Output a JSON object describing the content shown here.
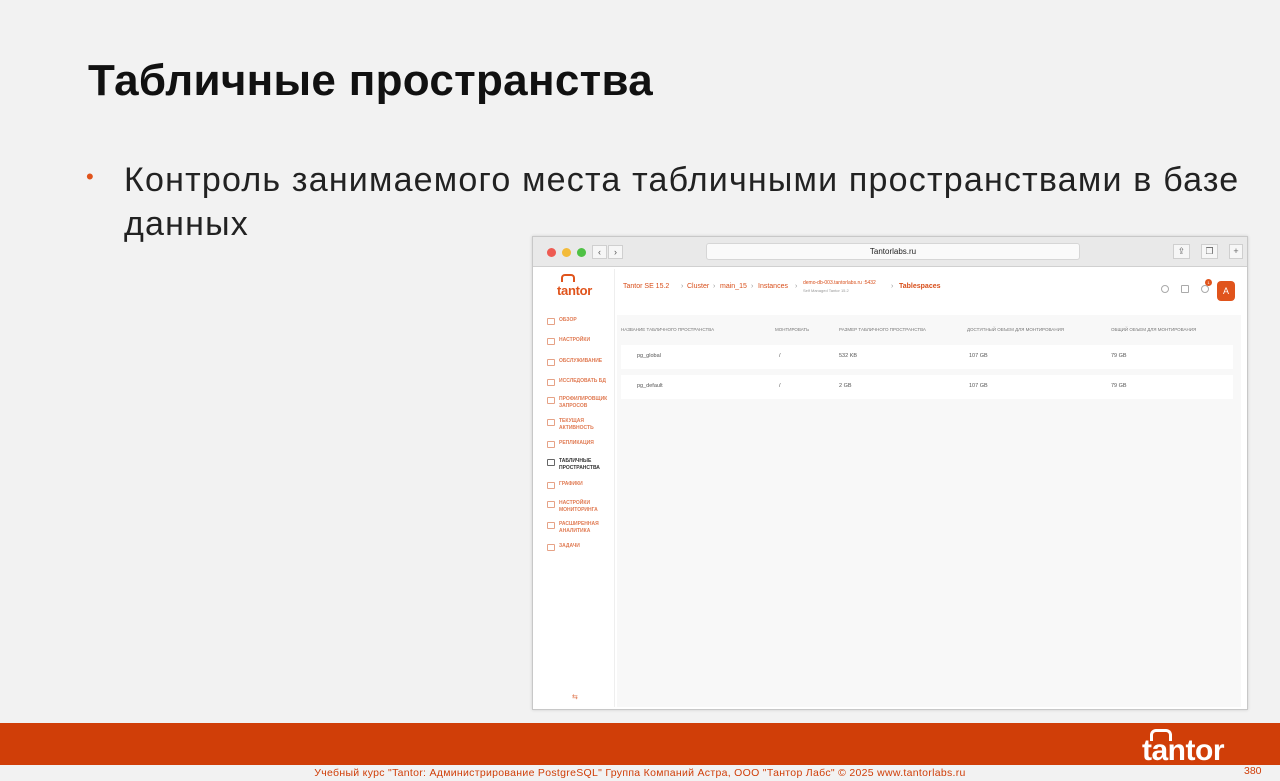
{
  "slide": {
    "title": "Табличные пространства",
    "bullet_text": "Контроль занимаемого места табличными пространствами в базе данных"
  },
  "browser": {
    "url": "Tantorlabs.ru"
  },
  "app": {
    "logo": "tantor",
    "breadcrumb": {
      "product": "Tantor SE 15.2",
      "cluster": "Cluster",
      "db": "main_15",
      "instances": "Instances",
      "host": "demo-db-003.tantorlabs.ru :5432",
      "host_sub": "Self Managed Tantor 15.2",
      "current": "Tablespaces"
    },
    "notifications_count": "1",
    "avatar_letter": "A",
    "sidebar": [
      {
        "label": "ОБЗОР",
        "icon": "overview-icon"
      },
      {
        "label": "НАСТРОЙКИ",
        "icon": "settings-icon"
      },
      {
        "label": "ОБСЛУЖИВАНИЕ",
        "icon": "maintenance-icon"
      },
      {
        "label": "ИССЛЕДОВАТЬ БД",
        "icon": "explore-icon"
      },
      {
        "label": "ПРОФИЛИРОВЩИК ЗАПРОСОВ",
        "icon": "profiler-icon"
      },
      {
        "label": "ТЕКУЩАЯ АКТИВНОСТЬ",
        "icon": "activity-icon"
      },
      {
        "label": "РЕПЛИКАЦИЯ",
        "icon": "replication-icon"
      },
      {
        "label": "ТАБЛИЧНЫЕ ПРОСТРАНСТВА",
        "icon": "tablespaces-icon",
        "active": true
      },
      {
        "label": "ГРАФИКИ",
        "icon": "graphs-icon"
      },
      {
        "label": "НАСТРОЙКИ МОНИТОРИНГА",
        "icon": "monitoring-settings-icon"
      },
      {
        "label": "РАСШИРЕННАЯ АНАЛИТИКА",
        "icon": "analytics-icon"
      },
      {
        "label": "ЗАДАЧИ",
        "icon": "tasks-icon"
      }
    ],
    "table": {
      "columns": [
        "НАЗВАНИЕ ТАБЛИЧНОГО ПРОСТРАНСТВА",
        "МОНТИРОВАТЬ",
        "РАЗМЕР ТАБЛИЧНОГО ПРОСТРАНСТВА",
        "ДОСТУПНЫЙ ОБЪЕМ ДЛЯ МОНТИРОВАНИЯ",
        "ОБЩИЙ ОБЪЕМ ДЛЯ МОНТИРОВАНИЯ"
      ],
      "rows": [
        [
          "pg_global",
          "/",
          "532 KB",
          "107 GB",
          "79 GB"
        ],
        [
          "pg_default",
          "/",
          "2 GB",
          "107 GB",
          "79 GB"
        ]
      ]
    }
  },
  "footer": {
    "text": "Учебный курс \"Tantor: Администрирование PostgreSQL\" Группа Компаний Астра, ООО \"Тантор Лабс\" © 2025  www.tantorlabs.ru",
    "page_number": "380",
    "logo": "tantor"
  },
  "colors": {
    "accent": "#d03e08",
    "bullet": "#e0541c"
  }
}
